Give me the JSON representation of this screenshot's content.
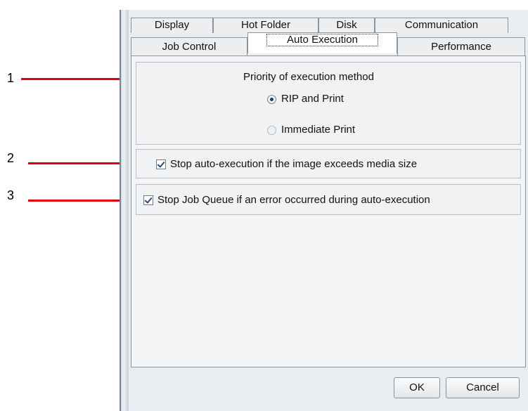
{
  "tabs": {
    "row1": [
      {
        "label": "Display"
      },
      {
        "label": "Hot Folder"
      },
      {
        "label": "Disk"
      },
      {
        "label": "Communication"
      }
    ],
    "row2": [
      {
        "label": "Job Control"
      },
      {
        "label": "Auto Execution",
        "active": true
      },
      {
        "label": "Performance"
      }
    ]
  },
  "priority": {
    "title": "Priority of execution method",
    "options": [
      {
        "label": "RIP and Print",
        "selected": true
      },
      {
        "label": "Immediate Print",
        "selected": false
      }
    ]
  },
  "checkboxes": [
    {
      "label": "Stop auto-execution if the image exceeds media size",
      "checked": true
    },
    {
      "label": "Stop Job Queue if an error occurred during auto-execution",
      "checked": true
    }
  ],
  "buttons": {
    "ok": "OK",
    "cancel": "Cancel"
  },
  "annotations": [
    "1",
    "2",
    "3"
  ],
  "colors": {
    "annotation_line": "#e3000f",
    "dialog_bg": "#e9edf2"
  }
}
